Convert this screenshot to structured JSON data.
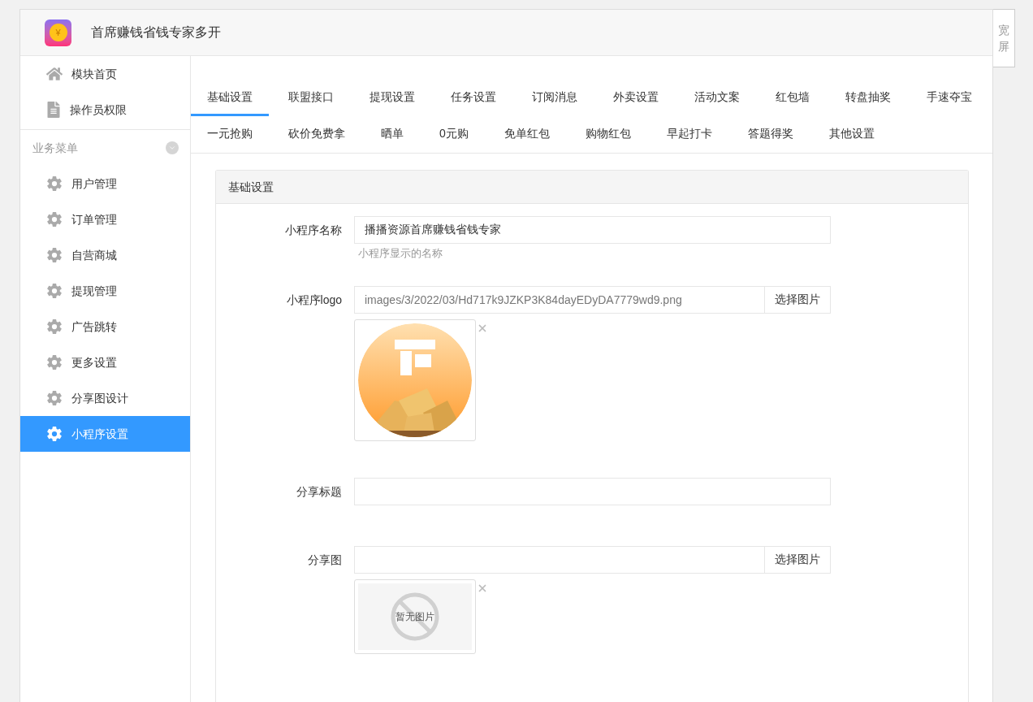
{
  "app": {
    "title": "首席赚钱省钱专家多开",
    "logo_glyph": "¥"
  },
  "widescreen_button": "宽屏",
  "sidebar": {
    "top_items": [
      {
        "label": "模块首页",
        "kind": "home"
      },
      {
        "label": "操作员权限",
        "kind": "document"
      }
    ],
    "section": {
      "title": "业务菜单"
    },
    "items": [
      {
        "label": "用户管理",
        "selected": false
      },
      {
        "label": "订单管理",
        "selected": false
      },
      {
        "label": "自营商城",
        "selected": false
      },
      {
        "label": "提现管理",
        "selected": false
      },
      {
        "label": "广告跳转",
        "selected": false
      },
      {
        "label": "更多设置",
        "selected": false
      },
      {
        "label": "分享图设计",
        "selected": false
      },
      {
        "label": "小程序设置",
        "selected": true
      }
    ]
  },
  "tab_rows": [
    [
      {
        "label": "基础设置",
        "selected": true
      },
      {
        "label": "联盟接口",
        "selected": false
      },
      {
        "label": "提现设置",
        "selected": false
      },
      {
        "label": "任务设置",
        "selected": false
      },
      {
        "label": "订阅消息",
        "selected": false
      },
      {
        "label": "外卖设置",
        "selected": false
      },
      {
        "label": "活动文案",
        "selected": false
      },
      {
        "label": "红包墙",
        "selected": false
      },
      {
        "label": "转盘抽奖",
        "selected": false
      },
      {
        "label": "手速夺宝",
        "selected": false
      }
    ],
    [
      {
        "label": "一元抢购",
        "selected": false
      },
      {
        "label": "砍价免费拿",
        "selected": false
      },
      {
        "label": "晒单",
        "selected": false
      },
      {
        "label": "0元购",
        "selected": false
      },
      {
        "label": "免单红包",
        "selected": false
      },
      {
        "label": "购物红包",
        "selected": false
      },
      {
        "label": "早起打卡",
        "selected": false
      },
      {
        "label": "答题得奖",
        "selected": false
      },
      {
        "label": "其他设置",
        "selected": false
      }
    ]
  ],
  "panel": {
    "title": "基础设置",
    "fields": [
      {
        "kind": "text",
        "label": "小程序名称",
        "value": "播播资源首席赚钱省钱专家",
        "help": "小程序显示的名称"
      },
      {
        "label": "小程序logo",
        "value": "images/3/2022/03/Hd717k9JZKP3K84dayEDyDA7779wd9.png",
        "button": "选择图片"
      },
      {
        "kind": "text",
        "label": "分享标题"
      },
      {
        "label": "分享图",
        "button": "选择图片",
        "preview": {
          "kind": "empty",
          "text": "暂无图片"
        }
      }
    ]
  }
}
